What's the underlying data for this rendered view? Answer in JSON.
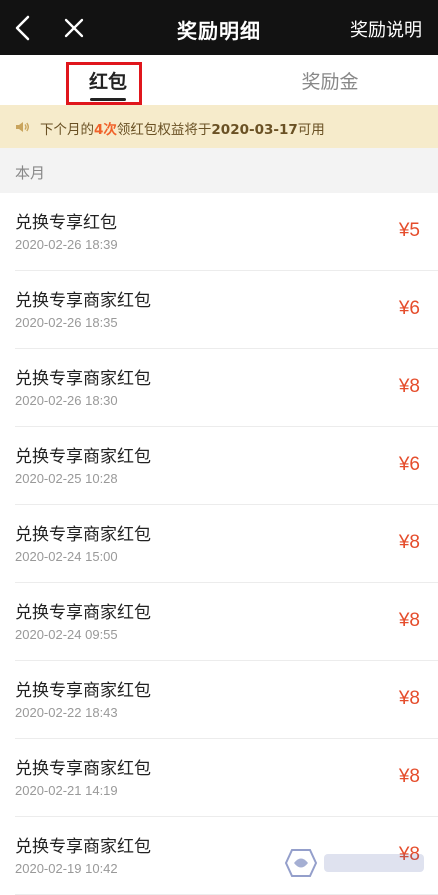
{
  "header": {
    "title": "奖励明细",
    "right_link": "奖励说明"
  },
  "tabs": [
    {
      "label": "红包"
    },
    {
      "label": "奖励金"
    }
  ],
  "notice": {
    "prefix": "下个月的",
    "count": "4次",
    "middle": "领红包权益将于",
    "date": "2020-03-17",
    "suffix": "可用"
  },
  "section": {
    "label": "本月"
  },
  "items": [
    {
      "name": "兑换专享红包",
      "time": "2020-02-26 18:39",
      "amount": "¥5"
    },
    {
      "name": "兑换专享商家红包",
      "time": "2020-02-26 18:35",
      "amount": "¥6"
    },
    {
      "name": "兑换专享商家红包",
      "time": "2020-02-26 18:30",
      "amount": "¥8"
    },
    {
      "name": "兑换专享商家红包",
      "time": "2020-02-25 10:28",
      "amount": "¥6"
    },
    {
      "name": "兑换专享商家红包",
      "time": "2020-02-24 15:00",
      "amount": "¥8"
    },
    {
      "name": "兑换专享商家红包",
      "time": "2020-02-24 09:55",
      "amount": "¥8"
    },
    {
      "name": "兑换专享商家红包",
      "time": "2020-02-22 18:43",
      "amount": "¥8"
    },
    {
      "name": "兑换专享商家红包",
      "time": "2020-02-21 14:19",
      "amount": "¥8"
    },
    {
      "name": "兑换专享商家红包",
      "time": "2020-02-19 10:42",
      "amount": "¥8"
    }
  ],
  "icons": {
    "back": "chevron-left-icon",
    "close": "close-icon",
    "notice": "speaker-icon",
    "watermark": "watermark-logo"
  },
  "colors": {
    "header_bg": "#121212",
    "notice_bg": "#f6ebcb",
    "amount": "#e54d2c",
    "highlight": "#e0161c"
  }
}
